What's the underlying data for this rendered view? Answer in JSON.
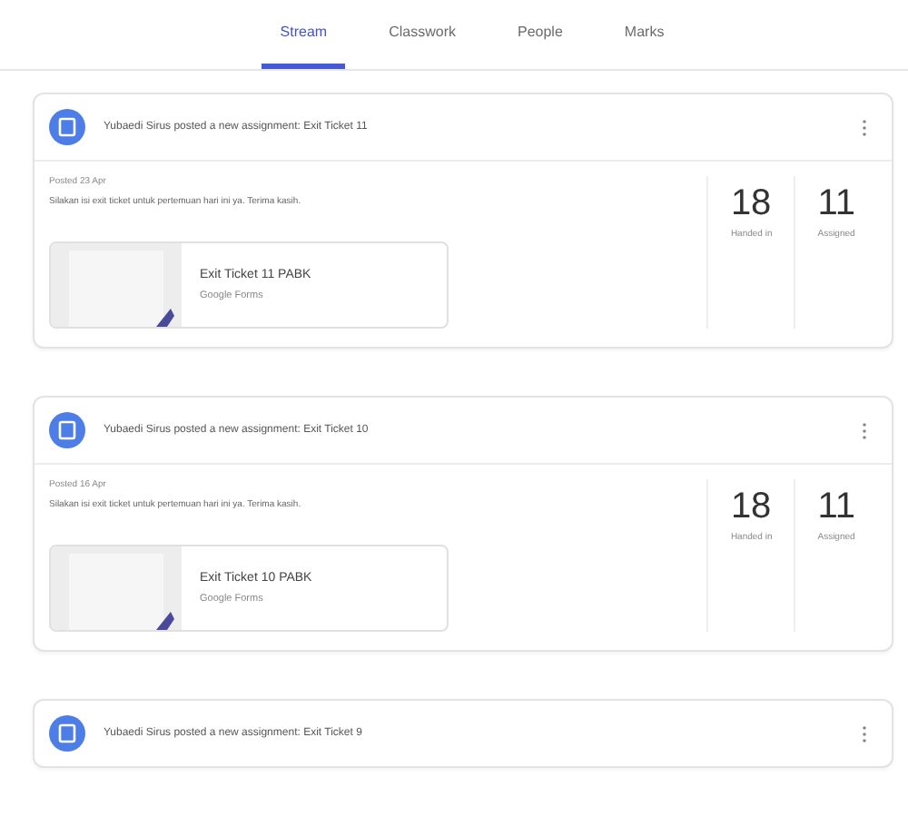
{
  "tabs": [
    {
      "label": "Stream",
      "selected": true
    },
    {
      "label": "Classwork",
      "selected": false
    },
    {
      "label": "People",
      "selected": false
    },
    {
      "label": "Marks",
      "selected": false
    }
  ],
  "posts": [
    {
      "title": "Yubaedi Sirus posted a new assignment: Exit Ticket 11",
      "expanded": true,
      "posted": "Posted 23 Apr",
      "description": "Silakan isi exit ticket untuk pertemuan hari ini ya. Terima kasih.",
      "stats": [
        {
          "value": "18",
          "label": "Handed in"
        },
        {
          "value": "11",
          "label": "Assigned"
        }
      ],
      "attachment": {
        "title": "Exit Ticket 11 PABK",
        "source": "Google Forms"
      }
    },
    {
      "title": "Yubaedi Sirus posted a new assignment: Exit Ticket 10",
      "expanded": true,
      "posted": "Posted 16 Apr",
      "description": "Silakan isi exit ticket untuk pertemuan hari ini ya. Terima kasih.",
      "stats": [
        {
          "value": "18",
          "label": "Handed in"
        },
        {
          "value": "11",
          "label": "Assigned"
        }
      ],
      "attachment": {
        "title": "Exit Ticket 10 PABK",
        "source": "Google Forms"
      }
    },
    {
      "title": "Yubaedi Sirus posted a new assignment: Exit Ticket 9",
      "expanded": false
    }
  ]
}
